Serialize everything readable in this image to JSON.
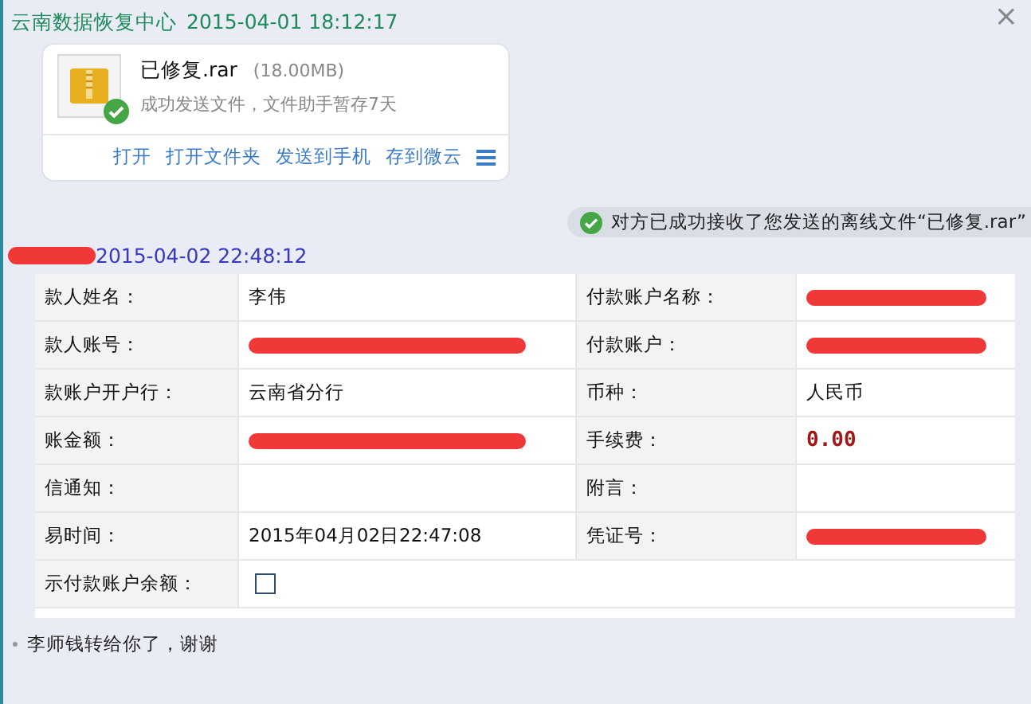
{
  "close": "×",
  "header": {
    "sender": "云南数据恢复中心",
    "time": "2015-04-01 18:12:17"
  },
  "file_card": {
    "name": "已修复.rar",
    "size": "(18.00MB)",
    "status": "成功发送文件，文件助手暂存7天",
    "sent": true,
    "actions": [
      "打开",
      "打开文件夹",
      "发送到手机",
      "存到微云"
    ]
  },
  "notice": {
    "text": "对方已成功接收了您发送的离线文件“已修复.rar”"
  },
  "message": {
    "sender_redacted": true,
    "time": "2015-04-02 22:48:12"
  },
  "receipt": {
    "rows": [
      {
        "cells": [
          {
            "kind": "label",
            "text": "款人姓名："
          },
          {
            "kind": "value",
            "text": "李伟"
          },
          {
            "kind": "label",
            "text": "付款账户名称："
          },
          {
            "kind": "redacted"
          }
        ]
      },
      {
        "cells": [
          {
            "kind": "label",
            "text": "款人账号："
          },
          {
            "kind": "redacted"
          },
          {
            "kind": "label",
            "text": "付款账户："
          },
          {
            "kind": "redacted"
          }
        ]
      },
      {
        "cells": [
          {
            "kind": "label",
            "text": "款账户开户行："
          },
          {
            "kind": "value",
            "text": "云南省分行"
          },
          {
            "kind": "label",
            "text": "币种："
          },
          {
            "kind": "value",
            "text": "人民币"
          }
        ]
      },
      {
        "cells": [
          {
            "kind": "label",
            "text": "账金额："
          },
          {
            "kind": "redacted"
          },
          {
            "kind": "label",
            "text": "手续费："
          },
          {
            "kind": "amount",
            "text": "0.00"
          }
        ]
      },
      {
        "cells": [
          {
            "kind": "label",
            "text": "信通知："
          },
          {
            "kind": "empty"
          },
          {
            "kind": "label",
            "text": "附言："
          },
          {
            "kind": "empty"
          }
        ]
      },
      {
        "cells": [
          {
            "kind": "label",
            "text": "易时间："
          },
          {
            "kind": "value",
            "text": "2015年04月02日22:47:08"
          },
          {
            "kind": "label",
            "text": "凭证号："
          },
          {
            "kind": "redacted"
          }
        ]
      },
      {
        "cells": [
          {
            "kind": "label",
            "text": "示付款账户余额："
          },
          {
            "kind": "checkbox",
            "checked": false
          }
        ]
      }
    ]
  },
  "reply": "李师钱转给你了，谢谢"
}
